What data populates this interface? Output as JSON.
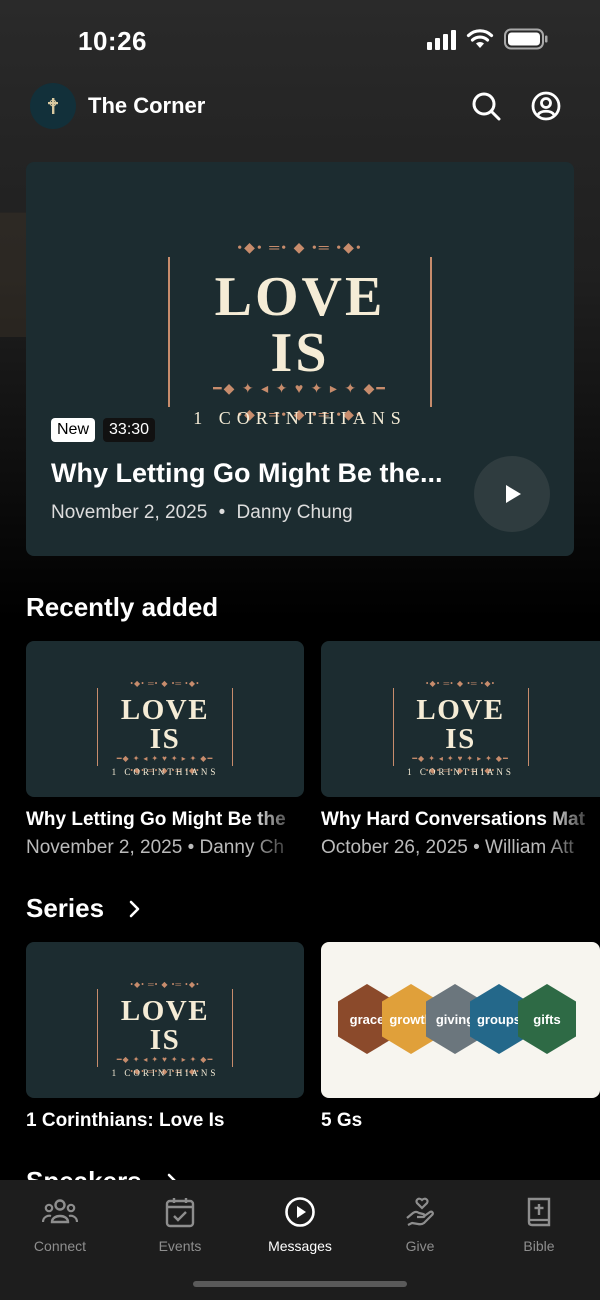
{
  "status_bar": {
    "time": "10:26"
  },
  "header": {
    "church_name": "The Corner"
  },
  "artwork": {
    "title": "LOVE IS",
    "subtitle": "1 CORINTHIANS",
    "ornament_top": "•◆• ═• ◆ •═ •◆•",
    "ornament_mid": "━◆ ✦ ◂ ✦ ♥ ✦ ▸ ✦ ◆━",
    "ornament_bot": "•◆• ═• ◆ •═ •◆•"
  },
  "featured": {
    "badge_new": "New",
    "duration": "33:30",
    "title": "Why Letting Go Might Be the...",
    "date": "November 2, 2025",
    "separator": "•",
    "speaker": "Danny Chung"
  },
  "recently_added": {
    "heading": "Recently added",
    "items": [
      {
        "title": "Why Letting Go Might Be the",
        "meta": "November 2, 2025 • Danny Ch"
      },
      {
        "title": "Why Hard Conversations Mat",
        "meta": "October 26, 2025 • William Att"
      }
    ]
  },
  "series": {
    "heading": "Series",
    "items": [
      {
        "title": "1 Corinthians: Love Is"
      },
      {
        "title": "5 Gs",
        "hexes": [
          {
            "label": "grace",
            "color": "#8b4a2b"
          },
          {
            "label": "growth",
            "color": "#e0a03a"
          },
          {
            "label": "giving",
            "color": "#6b767d"
          },
          {
            "label": "groups",
            "color": "#24688a"
          },
          {
            "label": "gifts",
            "color": "#2e6a45"
          }
        ]
      }
    ]
  },
  "speakers": {
    "heading": "Speakers"
  },
  "tabbar": {
    "tabs": [
      {
        "label": "Connect",
        "icon": "people-icon"
      },
      {
        "label": "Events",
        "icon": "calendar-check-icon"
      },
      {
        "label": "Messages",
        "icon": "play-circle-icon",
        "active": true
      },
      {
        "label": "Give",
        "icon": "hand-heart-icon"
      },
      {
        "label": "Bible",
        "icon": "bible-icon"
      }
    ]
  },
  "colors": {
    "card_bg": "#1c2c30",
    "accent_ornament": "#c78c6c",
    "tab_inactive": "#8e8e8e"
  }
}
